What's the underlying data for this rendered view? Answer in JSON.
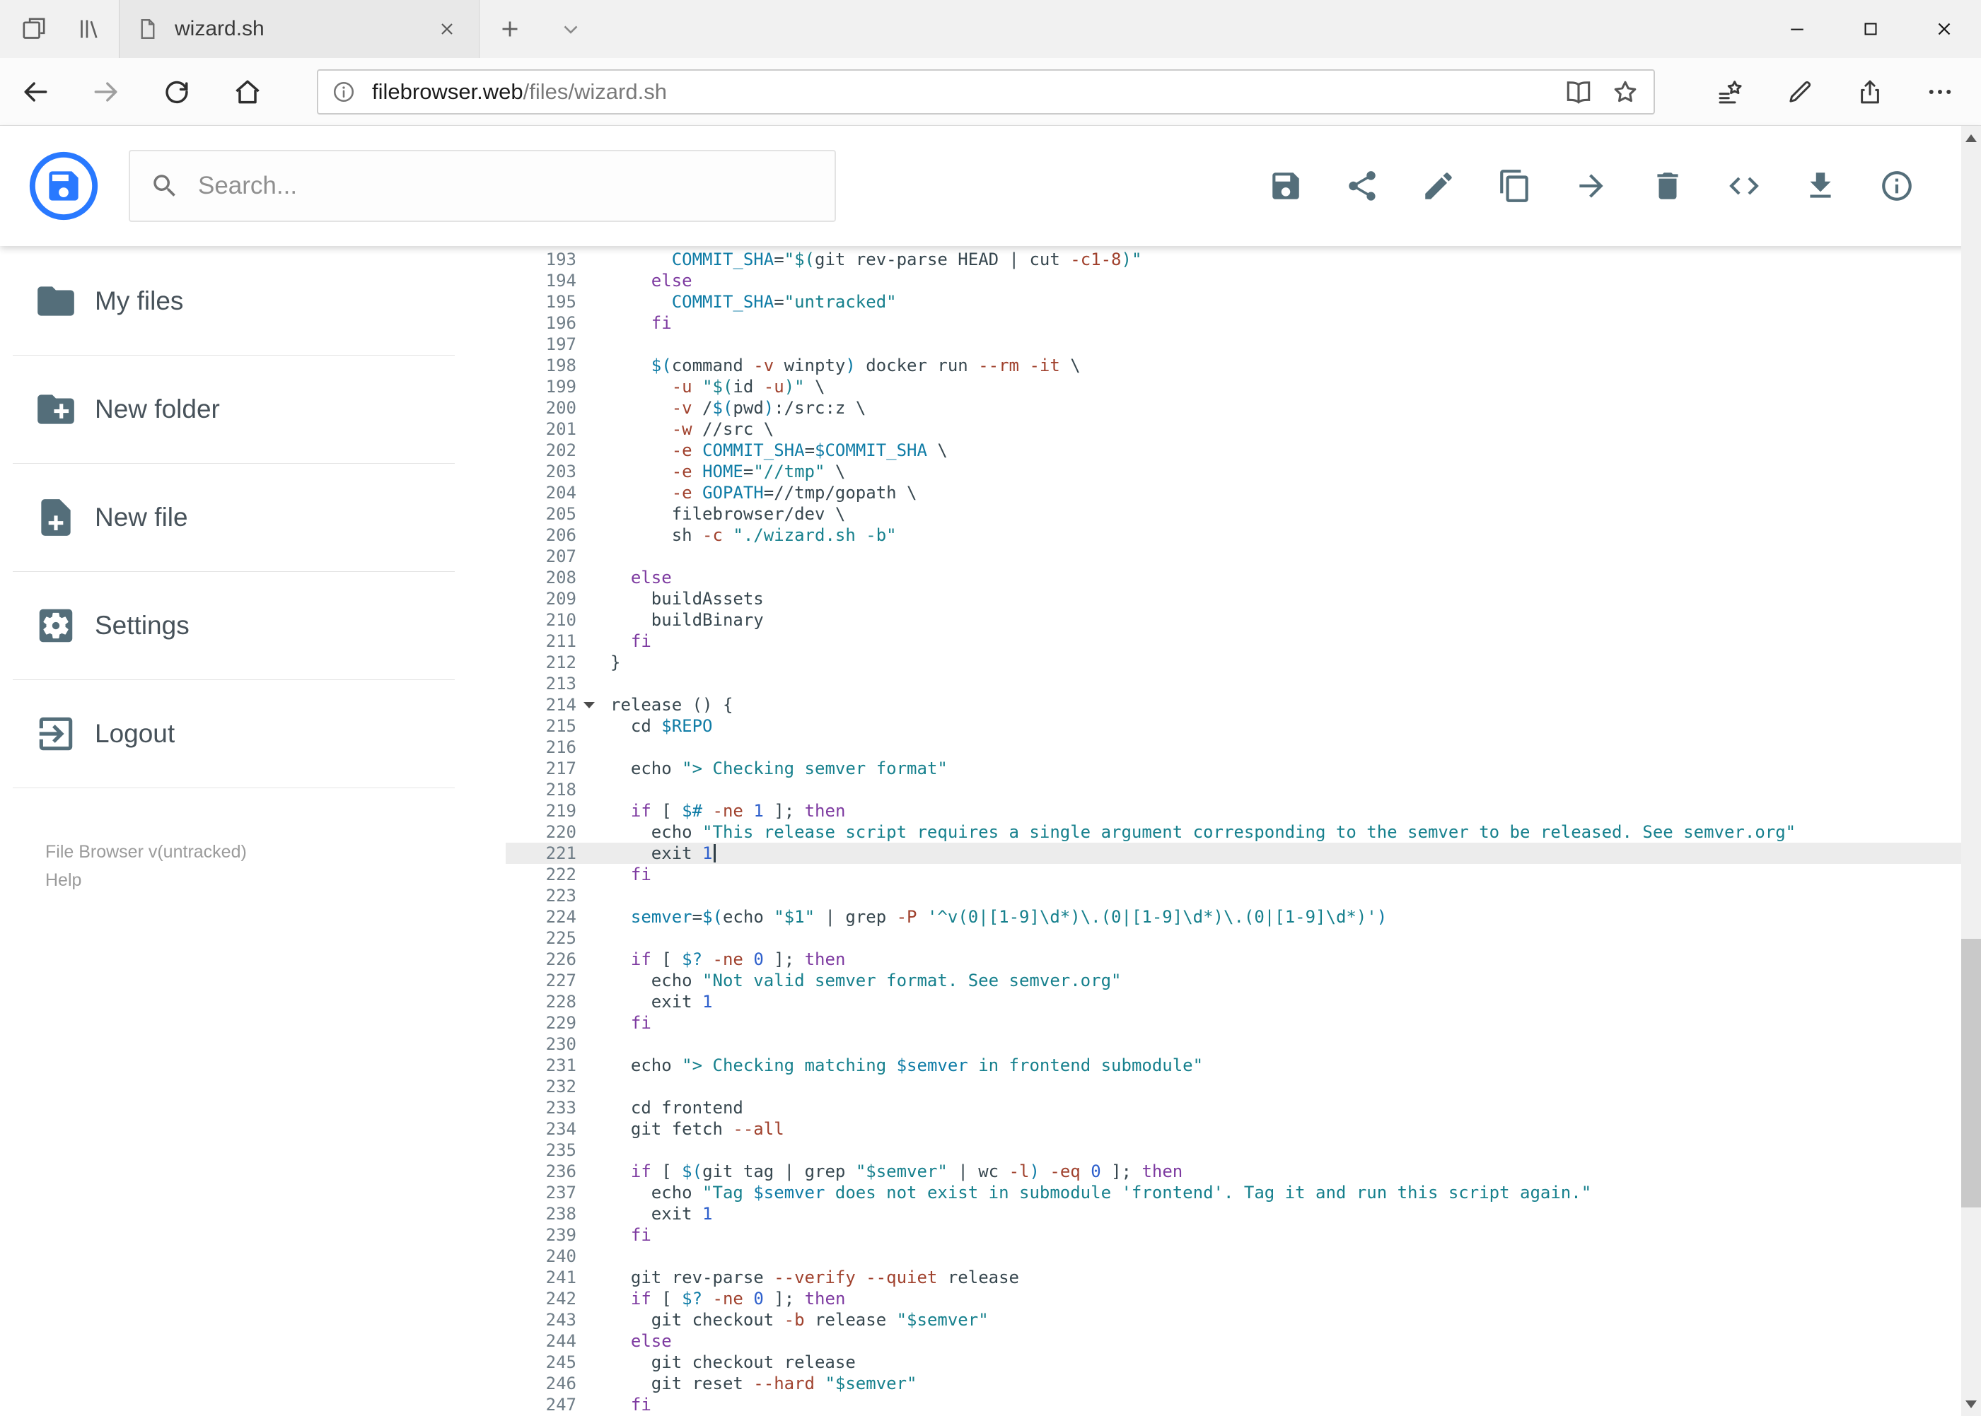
{
  "browser": {
    "tab_title": "wizard.sh",
    "url_host": "filebrowser.web",
    "url_path": "/files/wizard.sh"
  },
  "header": {
    "search_placeholder": "Search..."
  },
  "toolbar": {
    "icons": [
      "save",
      "share-dots",
      "edit",
      "copy",
      "forward-arrow",
      "delete",
      "code",
      "download",
      "info-outline"
    ]
  },
  "sidebar": {
    "items": [
      {
        "icon": "folder",
        "label": "My files"
      },
      {
        "icon": "folder-plus",
        "label": "New folder"
      },
      {
        "icon": "file-plus",
        "label": "New file"
      },
      {
        "icon": "settings",
        "label": "Settings"
      },
      {
        "icon": "logout",
        "label": "Logout"
      }
    ],
    "footer_version": "File Browser v(untracked)",
    "footer_help": "Help"
  },
  "colors": {
    "accent": "#2979ff",
    "icon-gray": "#546e7a",
    "kw": "#7d3aa0",
    "str": "#16808d",
    "var": "#0f7ca6",
    "opt": "#a0412d",
    "num": "#2d5fcc",
    "code-plain": "#37474f",
    "active-line": "#ececec"
  },
  "editor": {
    "active_line": 221,
    "cursor_line": 221,
    "fold_marker_line": 214,
    "first_line": 193,
    "last_line": 247,
    "lines": [
      {
        "n": 193,
        "t": [
          [
            "t",
            "      "
          ],
          [
            "v",
            "COMMIT_SHA"
          ],
          [
            "t",
            "="
          ],
          [
            "s",
            "\"$("
          ],
          [
            "t",
            "git rev-parse HEAD | cut "
          ],
          [
            "o",
            "-c1-8"
          ],
          [
            "s",
            ")\""
          ]
        ]
      },
      {
        "n": 194,
        "t": [
          [
            "t",
            "    "
          ],
          [
            "k",
            "else"
          ]
        ]
      },
      {
        "n": 195,
        "t": [
          [
            "t",
            "      "
          ],
          [
            "v",
            "COMMIT_SHA"
          ],
          [
            "t",
            "="
          ],
          [
            "s",
            "\"untracked\""
          ]
        ]
      },
      {
        "n": 196,
        "t": [
          [
            "t",
            "    "
          ],
          [
            "k",
            "fi"
          ]
        ]
      },
      {
        "n": 197,
        "t": []
      },
      {
        "n": 198,
        "t": [
          [
            "t",
            "    "
          ],
          [
            "v",
            "$("
          ],
          [
            "t",
            "command "
          ],
          [
            "o",
            "-v"
          ],
          [
            "t",
            " winpty"
          ],
          [
            "v",
            ")"
          ],
          [
            "t",
            " docker run "
          ],
          [
            "o",
            "--rm"
          ],
          [
            "t",
            " "
          ],
          [
            "o",
            "-it"
          ],
          [
            "t",
            " \\"
          ]
        ]
      },
      {
        "n": 199,
        "t": [
          [
            "t",
            "      "
          ],
          [
            "o",
            "-u"
          ],
          [
            "t",
            " "
          ],
          [
            "s",
            "\"$("
          ],
          [
            "t",
            "id "
          ],
          [
            "o",
            "-u"
          ],
          [
            "s",
            ")\""
          ],
          [
            "t",
            " \\"
          ]
        ]
      },
      {
        "n": 200,
        "t": [
          [
            "t",
            "      "
          ],
          [
            "o",
            "-v"
          ],
          [
            "t",
            " /"
          ],
          [
            "v",
            "$("
          ],
          [
            "t",
            "pwd"
          ],
          [
            "v",
            ")"
          ],
          [
            "t",
            ":/src:z \\"
          ]
        ]
      },
      {
        "n": 201,
        "t": [
          [
            "t",
            "      "
          ],
          [
            "o",
            "-w"
          ],
          [
            "t",
            " //src \\"
          ]
        ]
      },
      {
        "n": 202,
        "t": [
          [
            "t",
            "      "
          ],
          [
            "o",
            "-e"
          ],
          [
            "t",
            " "
          ],
          [
            "v",
            "COMMIT_SHA"
          ],
          [
            "t",
            "="
          ],
          [
            "v",
            "$COMMIT_SHA"
          ],
          [
            "t",
            " \\"
          ]
        ]
      },
      {
        "n": 203,
        "t": [
          [
            "t",
            "      "
          ],
          [
            "o",
            "-e"
          ],
          [
            "t",
            " "
          ],
          [
            "v",
            "HOME"
          ],
          [
            "t",
            "="
          ],
          [
            "s",
            "\"//tmp\""
          ],
          [
            "t",
            " \\"
          ]
        ]
      },
      {
        "n": 204,
        "t": [
          [
            "t",
            "      "
          ],
          [
            "o",
            "-e"
          ],
          [
            "t",
            " "
          ],
          [
            "v",
            "GOPATH"
          ],
          [
            "t",
            "=//tmp/gopath \\"
          ]
        ]
      },
      {
        "n": 205,
        "t": [
          [
            "t",
            "      filebrowser/dev \\"
          ]
        ]
      },
      {
        "n": 206,
        "t": [
          [
            "t",
            "      sh "
          ],
          [
            "o",
            "-c"
          ],
          [
            "t",
            " "
          ],
          [
            "s",
            "\"./wizard.sh -b\""
          ]
        ]
      },
      {
        "n": 207,
        "t": []
      },
      {
        "n": 208,
        "t": [
          [
            "t",
            "  "
          ],
          [
            "k",
            "else"
          ]
        ]
      },
      {
        "n": 209,
        "t": [
          [
            "t",
            "    buildAssets"
          ]
        ]
      },
      {
        "n": 210,
        "t": [
          [
            "t",
            "    buildBinary"
          ]
        ]
      },
      {
        "n": 211,
        "t": [
          [
            "t",
            "  "
          ],
          [
            "k",
            "fi"
          ]
        ]
      },
      {
        "n": 212,
        "t": [
          [
            "t",
            "}"
          ]
        ]
      },
      {
        "n": 213,
        "t": []
      },
      {
        "n": 214,
        "t": [
          [
            "t",
            "release () {"
          ]
        ]
      },
      {
        "n": 215,
        "t": [
          [
            "t",
            "  cd "
          ],
          [
            "v",
            "$REPO"
          ]
        ]
      },
      {
        "n": 216,
        "t": []
      },
      {
        "n": 217,
        "t": [
          [
            "t",
            "  echo "
          ],
          [
            "s",
            "\"> Checking semver format\""
          ]
        ]
      },
      {
        "n": 218,
        "t": []
      },
      {
        "n": 219,
        "t": [
          [
            "t",
            "  "
          ],
          [
            "k",
            "if"
          ],
          [
            "t",
            " [ "
          ],
          [
            "v",
            "$#"
          ],
          [
            "t",
            " "
          ],
          [
            "o",
            "-ne"
          ],
          [
            "t",
            " "
          ],
          [
            "n",
            "1"
          ],
          [
            "t",
            " ]; "
          ],
          [
            "k",
            "then"
          ]
        ]
      },
      {
        "n": 220,
        "t": [
          [
            "t",
            "    echo "
          ],
          [
            "s",
            "\"This release script requires a single argument corresponding to the semver to be released. See semver.org\""
          ]
        ]
      },
      {
        "n": 221,
        "t": [
          [
            "t",
            "    exit "
          ],
          [
            "n",
            "1"
          ]
        ]
      },
      {
        "n": 222,
        "t": [
          [
            "t",
            "  "
          ],
          [
            "k",
            "fi"
          ]
        ]
      },
      {
        "n": 223,
        "t": []
      },
      {
        "n": 224,
        "t": [
          [
            "t",
            "  "
          ],
          [
            "v",
            "semver"
          ],
          [
            "t",
            "="
          ],
          [
            "v",
            "$("
          ],
          [
            "t",
            "echo "
          ],
          [
            "s",
            "\"$1\""
          ],
          [
            "t",
            " | grep "
          ],
          [
            "o",
            "-P"
          ],
          [
            "t",
            " "
          ],
          [
            "s",
            "'^v(0|[1-9]\\d*)\\.(0|[1-9]\\d*)\\.(0|[1-9]\\d*)'"
          ],
          [
            "v",
            ")"
          ]
        ]
      },
      {
        "n": 225,
        "t": []
      },
      {
        "n": 226,
        "t": [
          [
            "t",
            "  "
          ],
          [
            "k",
            "if"
          ],
          [
            "t",
            " [ "
          ],
          [
            "v",
            "$?"
          ],
          [
            "t",
            " "
          ],
          [
            "o",
            "-ne"
          ],
          [
            "t",
            " "
          ],
          [
            "n",
            "0"
          ],
          [
            "t",
            " ]; "
          ],
          [
            "k",
            "then"
          ]
        ]
      },
      {
        "n": 227,
        "t": [
          [
            "t",
            "    echo "
          ],
          [
            "s",
            "\"Not valid semver format. See semver.org\""
          ]
        ]
      },
      {
        "n": 228,
        "t": [
          [
            "t",
            "    exit "
          ],
          [
            "n",
            "1"
          ]
        ]
      },
      {
        "n": 229,
        "t": [
          [
            "t",
            "  "
          ],
          [
            "k",
            "fi"
          ]
        ]
      },
      {
        "n": 230,
        "t": []
      },
      {
        "n": 231,
        "t": [
          [
            "t",
            "  echo "
          ],
          [
            "s",
            "\"> Checking matching "
          ],
          [
            "v",
            "$semver"
          ],
          [
            "s",
            " in frontend submodule\""
          ]
        ]
      },
      {
        "n": 232,
        "t": []
      },
      {
        "n": 233,
        "t": [
          [
            "t",
            "  cd frontend"
          ]
        ]
      },
      {
        "n": 234,
        "t": [
          [
            "t",
            "  git fetch "
          ],
          [
            "o",
            "--all"
          ]
        ]
      },
      {
        "n": 235,
        "t": []
      },
      {
        "n": 236,
        "t": [
          [
            "t",
            "  "
          ],
          [
            "k",
            "if"
          ],
          [
            "t",
            " [ "
          ],
          [
            "v",
            "$("
          ],
          [
            "t",
            "git tag | grep "
          ],
          [
            "s",
            "\"$semver\""
          ],
          [
            "t",
            " | wc "
          ],
          [
            "o",
            "-l"
          ],
          [
            "v",
            ")"
          ],
          [
            "t",
            " "
          ],
          [
            "o",
            "-eq"
          ],
          [
            "t",
            " "
          ],
          [
            "n",
            "0"
          ],
          [
            "t",
            " ]; "
          ],
          [
            "k",
            "then"
          ]
        ]
      },
      {
        "n": 237,
        "t": [
          [
            "t",
            "    echo "
          ],
          [
            "s",
            "\"Tag "
          ],
          [
            "v",
            "$semver"
          ],
          [
            "s",
            " does not exist in submodule 'frontend'. Tag it and run this script again.\""
          ]
        ]
      },
      {
        "n": 238,
        "t": [
          [
            "t",
            "    exit "
          ],
          [
            "n",
            "1"
          ]
        ]
      },
      {
        "n": 239,
        "t": [
          [
            "t",
            "  "
          ],
          [
            "k",
            "fi"
          ]
        ]
      },
      {
        "n": 240,
        "t": []
      },
      {
        "n": 241,
        "t": [
          [
            "t",
            "  git rev-parse "
          ],
          [
            "o",
            "--verify"
          ],
          [
            "t",
            " "
          ],
          [
            "o",
            "--quiet"
          ],
          [
            "t",
            " release"
          ]
        ]
      },
      {
        "n": 242,
        "t": [
          [
            "t",
            "  "
          ],
          [
            "k",
            "if"
          ],
          [
            "t",
            " [ "
          ],
          [
            "v",
            "$?"
          ],
          [
            "t",
            " "
          ],
          [
            "o",
            "-ne"
          ],
          [
            "t",
            " "
          ],
          [
            "n",
            "0"
          ],
          [
            "t",
            " ]; "
          ],
          [
            "k",
            "then"
          ]
        ]
      },
      {
        "n": 243,
        "t": [
          [
            "t",
            "    git checkout "
          ],
          [
            "o",
            "-b"
          ],
          [
            "t",
            " release "
          ],
          [
            "s",
            "\"$semver\""
          ]
        ]
      },
      {
        "n": 244,
        "t": [
          [
            "t",
            "  "
          ],
          [
            "k",
            "else"
          ]
        ]
      },
      {
        "n": 245,
        "t": [
          [
            "t",
            "    git checkout release"
          ]
        ]
      },
      {
        "n": 246,
        "t": [
          [
            "t",
            "    git reset "
          ],
          [
            "o",
            "--hard"
          ],
          [
            "t",
            " "
          ],
          [
            "s",
            "\"$semver\""
          ]
        ]
      },
      {
        "n": 247,
        "t": [
          [
            "t",
            "  "
          ],
          [
            "k",
            "fi"
          ]
        ]
      }
    ]
  }
}
